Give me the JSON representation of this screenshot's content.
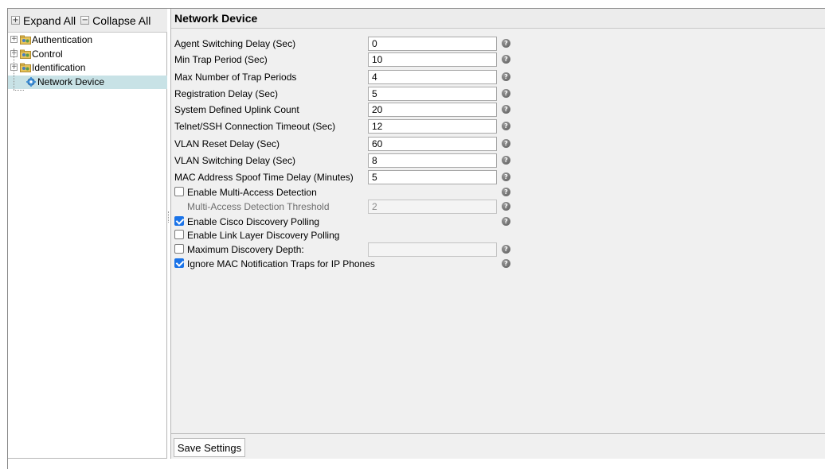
{
  "tree_toolbar": {
    "expand_all_label": "Expand All",
    "collapse_all_label": "Collapse All"
  },
  "tree": {
    "items": [
      {
        "label": "Authentication",
        "icon": "folder-group-icon",
        "expandable": true
      },
      {
        "label": "Control",
        "icon": "folder-group-icon",
        "expandable": true
      },
      {
        "label": "Identification",
        "icon": "folder-group-icon",
        "expandable": true
      },
      {
        "label": "Network Device",
        "icon": "gear-icon",
        "expandable": false,
        "selected": true
      }
    ]
  },
  "panel": {
    "title": "Network Device"
  },
  "form": {
    "agent_switching_delay": {
      "label": "Agent Switching Delay (Sec)",
      "value": "0"
    },
    "min_trap_period": {
      "label": "Min Trap Period (Sec)",
      "value": "10"
    },
    "max_trap_periods": {
      "label": "Max Number of Trap Periods",
      "value": "4"
    },
    "registration_delay": {
      "label": "Registration Delay (Sec)",
      "value": "5"
    },
    "uplink_count": {
      "label": "System Defined Uplink Count",
      "value": "20"
    },
    "telnet_timeout": {
      "label": "Telnet/SSH Connection Timeout (Sec)",
      "value": "12"
    },
    "vlan_reset_delay": {
      "label": "VLAN Reset Delay (Sec)",
      "value": "60"
    },
    "vlan_switching_delay": {
      "label": "VLAN Switching Delay (Sec)",
      "value": "8"
    },
    "mac_spoof_delay": {
      "label": "MAC Address Spoof Time Delay (Minutes)",
      "value": "5"
    },
    "multi_access_detection": {
      "label": "Enable Multi-Access Detection",
      "checked": false
    },
    "multi_access_threshold": {
      "label": "Multi-Access Detection Threshold",
      "value": "2",
      "disabled": true
    },
    "cisco_discovery": {
      "label": "Enable Cisco Discovery Polling",
      "checked": true
    },
    "link_layer_discovery": {
      "label": "Enable Link Layer Discovery Polling",
      "checked": false
    },
    "max_discovery_depth": {
      "label": "Maximum Discovery Depth:",
      "checked": false,
      "value": "",
      "disabled": true
    },
    "ignore_mac_traps": {
      "label": "Ignore MAC Notification Traps for IP Phones",
      "checked": true
    }
  },
  "footer": {
    "save_label": "Save Settings"
  },
  "colors": {
    "selected_row": "#c8e2e6",
    "checkbox_checked": "#1a73e8",
    "panel_bg": "#f0f0f0"
  }
}
